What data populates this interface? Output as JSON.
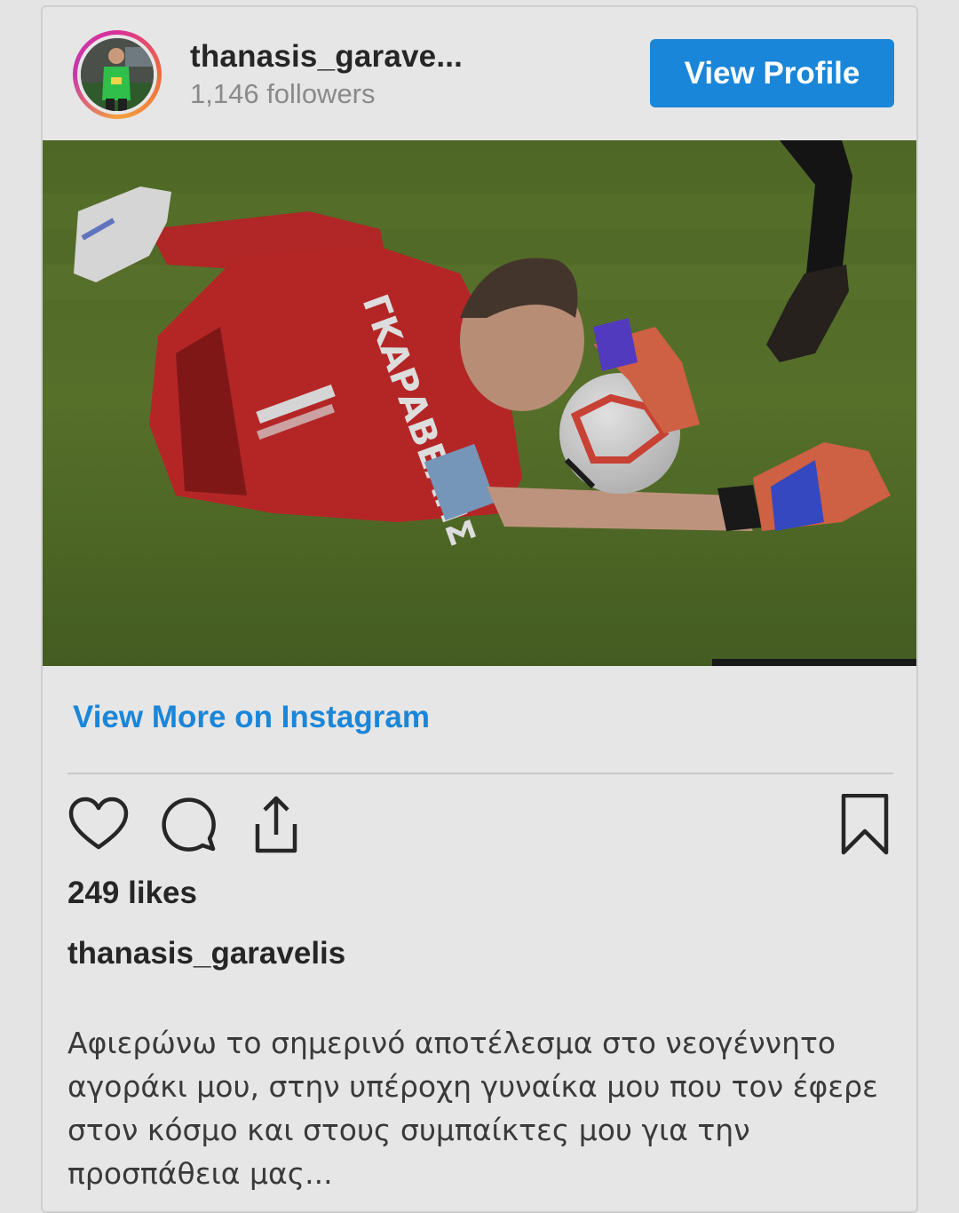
{
  "post": {
    "header": {
      "username": "thanasis_garave...",
      "followers": "1,146 followers",
      "view_profile_label": "View Profile"
    },
    "photo_icon": "goalkeeper-photo",
    "view_more_label": "View More on Instagram",
    "actions": {
      "like_icon": "heart-icon",
      "comment_icon": "comment-icon",
      "share_icon": "share-icon",
      "save_icon": "bookmark-icon"
    },
    "likes": "249 likes",
    "author": "thanasis_garavelis",
    "caption": "Αφιερώνω το σημερινό αποτέλεσμα στο νεογέννητο αγοράκι μου, στην υπέροχη γυναίκα μου που τον έφερε στον κόσμο και στους συμπαίκτες μου για την προσπάθεια μας..."
  },
  "colors": {
    "accent": "#1a86d9",
    "text": "#262626",
    "muted": "#8a8a8a",
    "background": "#e6e6e6"
  }
}
